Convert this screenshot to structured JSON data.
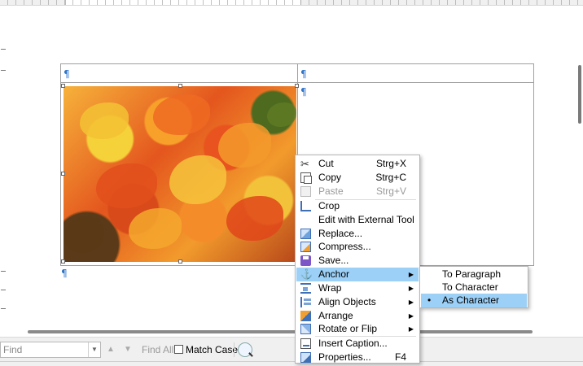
{
  "context_menu": {
    "items": [
      {
        "label": "Cut",
        "shortcut": "Strg+X",
        "icon": "scissors-icon"
      },
      {
        "label": "Copy",
        "shortcut": "Strg+C",
        "icon": "copy-icon"
      },
      {
        "label": "Paste",
        "shortcut": "Strg+V",
        "icon": "paste-icon",
        "disabled": true
      },
      {
        "label": "Crop",
        "icon": "crop-icon"
      },
      {
        "label": "Edit with External Tool"
      },
      {
        "label": "Replace...",
        "icon": "replace-image-icon"
      },
      {
        "label": "Compress...",
        "icon": "compress-image-icon"
      },
      {
        "label": "Save...",
        "icon": "save-icon"
      },
      {
        "label": "Anchor",
        "icon": "anchor-icon",
        "submenu": true,
        "highlighted": true
      },
      {
        "label": "Wrap",
        "icon": "wrap-icon",
        "submenu": true
      },
      {
        "label": "Align Objects",
        "icon": "align-objects-icon",
        "submenu": true
      },
      {
        "label": "Arrange",
        "icon": "arrange-icon",
        "submenu": true
      },
      {
        "label": "Rotate or Flip",
        "icon": "rotate-flip-icon",
        "submenu": true
      },
      {
        "label": "Insert Caption...",
        "icon": "insert-caption-icon"
      },
      {
        "label": "Properties...",
        "shortcut": "F4",
        "icon": "properties-icon"
      }
    ]
  },
  "anchor_submenu": {
    "items": [
      {
        "label": "To Paragraph"
      },
      {
        "label": "To Character"
      },
      {
        "label": "As Character",
        "selected": true
      }
    ]
  },
  "find_toolbar": {
    "placeholder": "Find",
    "find_all_label": "Find All",
    "match_case_label": "Match Case"
  },
  "document": {
    "paragraph_mark": "¶"
  },
  "colors": {
    "menu_highlight": "#9cd0f7",
    "paragraph_mark": "#2e74c9"
  }
}
